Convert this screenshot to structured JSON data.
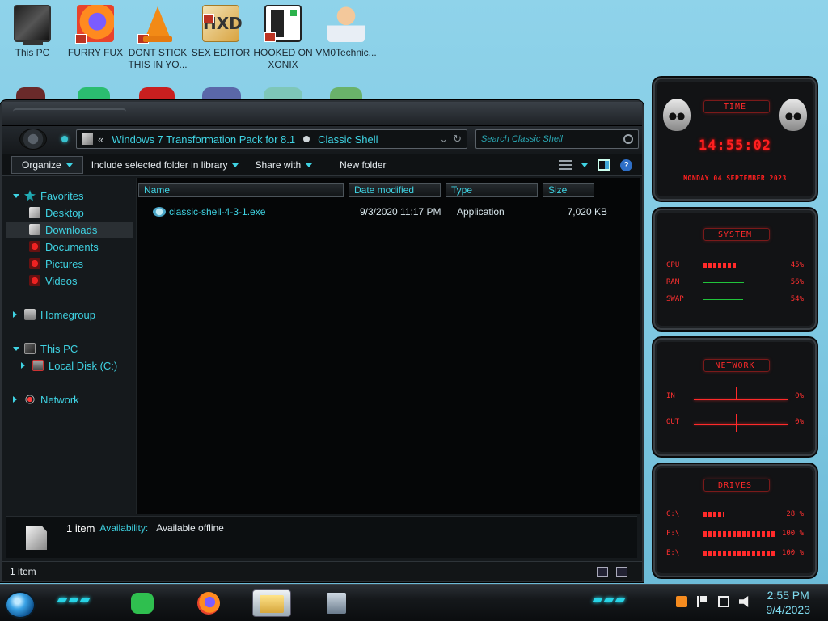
{
  "desktop": {
    "icons": [
      {
        "label": "This PC",
        "icon": "computer-icon"
      },
      {
        "label": "FURRY FUX",
        "icon": "firefox-icon"
      },
      {
        "label": "DONT STICK THIS IN YO...",
        "icon": "vlc-icon"
      },
      {
        "label": "SEX EDITOR",
        "icon": "hex-editor-icon"
      },
      {
        "label": "HOOKED ON XONIX",
        "icon": "xonix-icon"
      },
      {
        "label": "VM0Technic...",
        "icon": "doctor-icon"
      }
    ]
  },
  "explorer": {
    "address": {
      "back_glyph": "«",
      "crumbs": [
        "Windows 7 Transformation Pack for 8.1",
        "Classic Shell"
      ]
    },
    "search": {
      "placeholder": "Search Classic Shell"
    },
    "toolbar": {
      "organize": "Organize",
      "include": "Include selected folder in library",
      "share": "Share with",
      "new_folder": "New folder"
    },
    "nav": {
      "favorites": "Favorites",
      "desktop": "Desktop",
      "downloads": "Downloads",
      "documents": "Documents",
      "pictures": "Pictures",
      "videos": "Videos",
      "homegroup": "Homegroup",
      "this_pc": "This PC",
      "local_disk": "Local Disk (C:)",
      "network": "Network"
    },
    "columns": {
      "name": "Name",
      "date": "Date modified",
      "type": "Type",
      "size": "Size"
    },
    "files": [
      {
        "name": "classic-shell-4-3-1.exe",
        "date": "9/3/2020 11:17 PM",
        "type": "Application",
        "size": "7,020 KB"
      }
    ],
    "details": {
      "count": "1 item",
      "availability_label": "Availability:",
      "availability_value": "Available offline"
    },
    "status": {
      "count": "1 item"
    }
  },
  "gadgets": {
    "time": {
      "title": "TIME",
      "clock": "14:55:02",
      "date": "MONDAY 04 SEPTEMBER 2023"
    },
    "system": {
      "title": "SYSTEM",
      "rows": [
        {
          "name": "CPU",
          "pct": "45%",
          "value": 0.45
        },
        {
          "name": "RAM",
          "pct": "56%",
          "value": 0.56
        },
        {
          "name": "SWAP",
          "pct": "54%",
          "value": 0.54
        }
      ]
    },
    "network": {
      "title": "NETWORK",
      "rows": [
        {
          "name": "IN",
          "pct": "0%"
        },
        {
          "name": "OUT",
          "pct": "0%"
        }
      ]
    },
    "drives": {
      "title": "DRIVES",
      "rows": [
        {
          "name": "C:\\",
          "pct": "28 %",
          "value": 0.28
        },
        {
          "name": "F:\\",
          "pct": "100 %",
          "value": 1.0
        },
        {
          "name": "E:\\",
          "pct": "100 %",
          "value": 1.0
        }
      ]
    },
    "accent": "#ff2020"
  },
  "taskbar": {
    "time": "2:55 PM",
    "date": "9/4/2023",
    "apps": [
      "notes-app-icon",
      "firefox-icon",
      "file-explorer-icon",
      "network-tool-icon"
    ]
  }
}
